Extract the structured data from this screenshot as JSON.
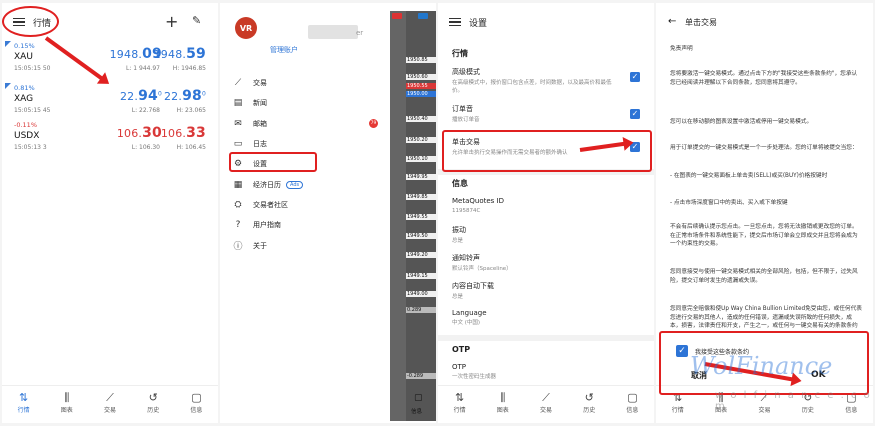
{
  "panel1": {
    "title": "行情",
    "quotes": [
      {
        "change": "0.15%",
        "symbol": "XAU",
        "time": "15:05:15  50",
        "bid_main": "1948.",
        "bid_big": "09",
        "ask_main": "1948.",
        "ask_big": "59",
        "low": "L: 1 944.97",
        "high": "H: 1946.85",
        "color": "#2d74d6"
      },
      {
        "change": "0.81%",
        "symbol": "XAG",
        "time": "15:05:15  45",
        "bid_main": "22.",
        "bid_big": "94",
        "bid_sup": "0",
        "ask_main": "22.",
        "ask_big": "98",
        "ask_sup": "0",
        "low": "L: 22.768",
        "high": "H: 23.065",
        "color": "#2d74d6"
      },
      {
        "change": "-0.11%",
        "symbol": "USDX",
        "time": "15:05:13  3",
        "bid_main": "106.",
        "bid_big": "30",
        "ask_main": "106.",
        "ask_big": "33",
        "low": "L: 106.30",
        "high": "H: 106.45",
        "color": "#d93838"
      }
    ],
    "nav": [
      "行情",
      "图表",
      "交易",
      "历史",
      "信息"
    ]
  },
  "panel2": {
    "avatar_text": "VR",
    "account_suffix": "er",
    "manage_label": "管理账户",
    "menu": [
      {
        "icon": "trade-icon",
        "label": "交易"
      },
      {
        "icon": "news-icon",
        "label": "新闻"
      },
      {
        "icon": "mail-icon",
        "label": "邮箱",
        "badge": "79"
      },
      {
        "icon": "journal-icon",
        "label": "日志"
      },
      {
        "icon": "settings-icon",
        "label": "设置"
      },
      {
        "icon": "calendar-icon",
        "label": "经济日历",
        "tag": "Ads"
      },
      {
        "icon": "community-icon",
        "label": "交易者社区"
      },
      {
        "icon": "help-icon",
        "label": "用户指南"
      },
      {
        "icon": "about-icon",
        "label": "关于"
      }
    ],
    "price_ticks": [
      "1950.85",
      "1950.60",
      "1950.40",
      "1950.20",
      "1950.10",
      "1949.95",
      "1949.85",
      "1949.55",
      "1949.50",
      "1949.20",
      "1949.15",
      "1949.00"
    ],
    "highlight_ticks": [
      "1950.55",
      "1950.00"
    ],
    "bottom_ticks": [
      "0.289",
      "-0.289"
    ],
    "side_label": "信息"
  },
  "panel3": {
    "title": "设置",
    "section_quotes": "行情",
    "rows": [
      {
        "title": "高级模式",
        "sub": "在高级模式中，报价窗口包含点差，时间数据，以及最高价和最低价。",
        "checked": true
      },
      {
        "title": "订单音",
        "sub": "播放订单音",
        "checked": true
      },
      {
        "title": "单击交易",
        "sub": "允许单击执行交易操作而无需交易者的额外确认",
        "checked": true
      }
    ],
    "section_info": "信息",
    "info_rows": [
      {
        "title": "MetaQuotes ID",
        "sub": "1195874C"
      },
      {
        "title": "振动",
        "sub": "总是"
      },
      {
        "title": "通知铃声",
        "sub": "默认铃声（Spaceline）"
      },
      {
        "title": "内容自动下载",
        "sub": "总是"
      },
      {
        "title": "Language",
        "sub": "中文 (中国)"
      }
    ],
    "section_otp": "OTP",
    "otp_row": {
      "title": "OTP",
      "sub": "一次性密码生成器"
    }
  },
  "panel4": {
    "title": "单击交易",
    "heading": "免责声明",
    "paragraphs": [
      "您将要激活一键交易模式。通过点击下方的\"我接受这些条款条约\"，您承认您已经阅读并理解以下合同条款，您同意将其遵守。",
      "您可以在移动额的图表设置中激活或停用一键交易模式。",
      "用于订单提交的一键交易模式是一个一步处理法。您的订单将被提交当您：",
      "- 在图表的一键交易面板上单击卖(SELL)或买(BUY)价格按键时",
      "- 点击市场深度窗口中的卖出、买入或下单按键",
      "不会有后续确认提示您点击。一旦您点击，您将无法撤销或更改您的订单。在正常市场条件和系统性能下，提交后市场订单会立即成交并且您将会成为一个约束性的交易。",
      "您同意接受与使用一键交易模式相关的全部风险，包括，但不限于，过失风险，提交订单时发生的遗漏或失误。",
      "您同意完全赔偿和使Up Way China Bullion Limited免受由您，或任何代表您进行交易的其他人，造成的任何错误，遗漏或失误所致的任何损失，成本，损害，法律责任和开支，产生之一，或任何与一键交易有关的条款条约"
    ],
    "agree_label": "我接受这些条款条约",
    "cancel_label": "取消",
    "ok_label": "OK",
    "nav": [
      "行情",
      "图表",
      "交易",
      "历史",
      "信息"
    ]
  },
  "watermark": {
    "brand": "WolFinance",
    "site": "w o l f i n a n c e . c o m"
  },
  "colors": {
    "accent": "#2d74d6",
    "down": "#d93838",
    "annotation": "#e02020"
  }
}
